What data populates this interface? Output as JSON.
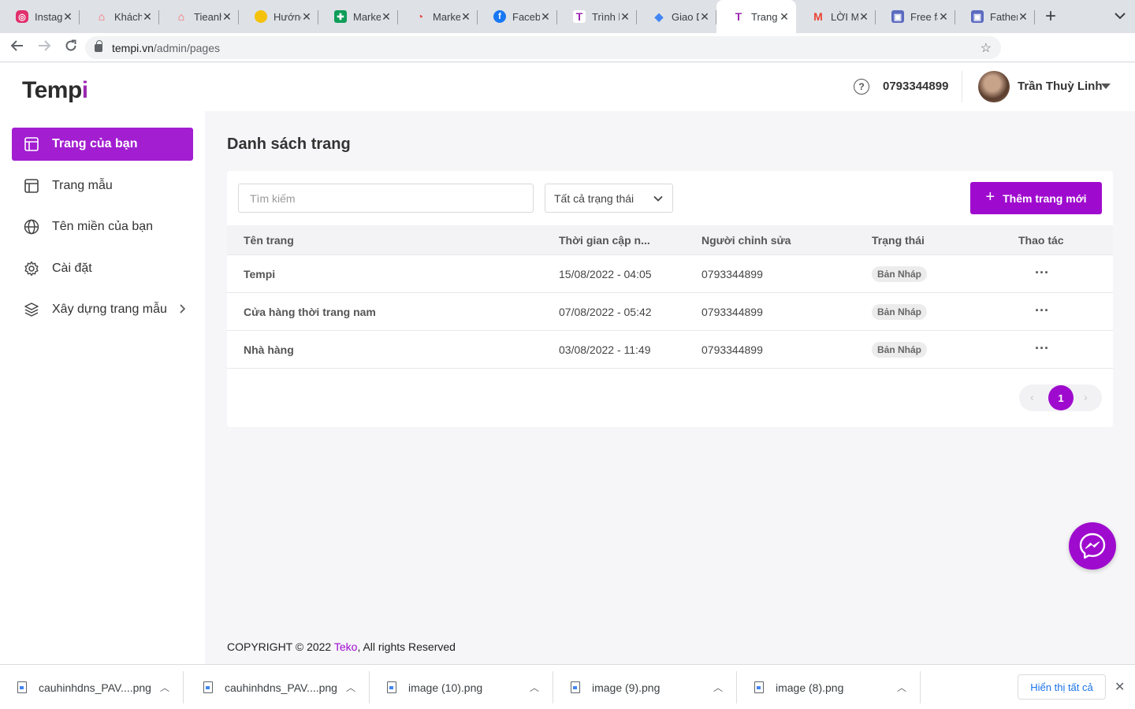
{
  "browser": {
    "tabs": [
      {
        "title": "Instagram",
        "icon": "instagram-icon",
        "color": "#e1306c"
      },
      {
        "title": "Khách",
        "icon": "airbnb-icon",
        "color": "#ff5a5f"
      },
      {
        "title": "Tieanh",
        "icon": "airbnb-icon",
        "color": "#ff5a5f"
      },
      {
        "title": "Hướng",
        "icon": "lemon-icon",
        "color": "#f4c20d"
      },
      {
        "title": "Marke",
        "icon": "sheets-icon",
        "color": "#0f9d58"
      },
      {
        "title": "Marke",
        "icon": "app-icon",
        "color": "#e8453c"
      },
      {
        "title": "Faceb",
        "icon": "facebook-icon",
        "color": "#1877f2"
      },
      {
        "title": "Trình k",
        "icon": "tempi-icon",
        "color": "#9c27b0"
      },
      {
        "title": "Giao D",
        "icon": "layers-icon",
        "color": "#4285f4"
      },
      {
        "title": "Trang",
        "icon": "tempi-icon",
        "color": "#9c27b0",
        "active": true
      },
      {
        "title": "LỜI M",
        "icon": "gmail-icon",
        "color": "#ea4335"
      },
      {
        "title": "Free fa",
        "icon": "app-icon",
        "color": "#5c6bc0"
      },
      {
        "title": "Father",
        "icon": "app-icon",
        "color": "#5c6bc0"
      }
    ],
    "url_host": "tempi.vn",
    "url_path": "/admin/pages"
  },
  "app": {
    "logo_main": "Temp",
    "logo_accent": "i",
    "accent_color": "#9f0bce",
    "sidebar": [
      {
        "label": "Trang của bạn",
        "icon": "layout-icon",
        "active": true
      },
      {
        "label": "Trang mẫu",
        "icon": "layout-icon"
      },
      {
        "label": "Tên miền của bạn",
        "icon": "globe-icon"
      },
      {
        "label": "Cài đặt",
        "icon": "gear-icon"
      },
      {
        "label": "Xây dựng trang mẫu",
        "icon": "layers-icon",
        "has_submenu": true
      }
    ],
    "header": {
      "phone": "0793344899",
      "user_name": "Trần Thuỳ Linh"
    },
    "page_title": "Danh sách trang",
    "search_placeholder": "Tìm kiếm",
    "status_filter": "Tất cả trạng thái",
    "add_button": "Thêm trang mới",
    "table": {
      "columns": [
        "Tên trang",
        "Thời gian cập n...",
        "Người chỉnh sửa",
        "Trạng thái",
        "Thao tác"
      ],
      "rows": [
        {
          "name": "Tempi",
          "updated": "15/08/2022 - 04:05",
          "editor": "0793344899",
          "status": "Bản Nháp"
        },
        {
          "name": "Cửa hàng thời trang nam",
          "updated": "07/08/2022 - 05:42",
          "editor": "0793344899",
          "status": "Bản Nháp"
        },
        {
          "name": "Nhà hàng",
          "updated": "03/08/2022 - 11:49",
          "editor": "0793344899",
          "status": "Bản Nháp"
        }
      ]
    },
    "pagination": {
      "current": "1"
    },
    "footer": {
      "prefix": "COPYRIGHT © 2022 ",
      "brand": "Teko",
      "suffix": ", All rights Reserved"
    }
  },
  "downloads": {
    "items": [
      "cauhinhdns_PAV....png",
      "cauhinhdns_PAV....png",
      "image (10).png",
      "image (9).png",
      "image (8).png"
    ],
    "show_all": "Hiển thị tất cả"
  }
}
